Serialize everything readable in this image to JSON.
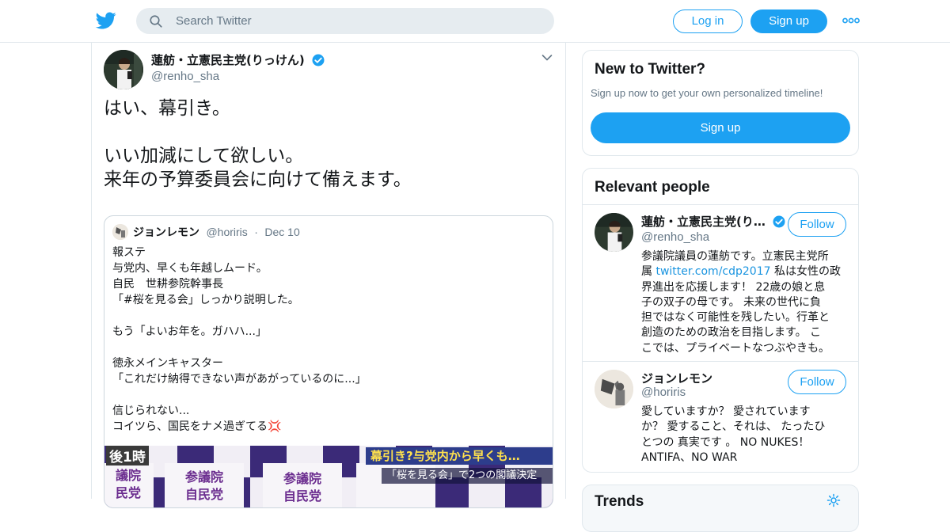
{
  "header": {
    "search_placeholder": "Search Twitter",
    "login_label": "Log in",
    "signup_label": "Sign up",
    "brand_color": "#1da1f2"
  },
  "tweet": {
    "author_name": "蓮舫・立憲民主党(りっけん)",
    "author_handle": "@renho_sha",
    "verified": true,
    "text_lines": [
      "はい、幕引き。",
      "",
      "いい加減にして欲しい。",
      "来年の予算委員会に向けて備えます。"
    ],
    "quote": {
      "author_name": "ジョンレモン",
      "author_handle": "@horiris",
      "separator": "·",
      "date": "Dec 10",
      "lines": [
        "報ステ",
        "与党内、早くも年越しムード。",
        "自民　世耕参院幹事長",
        "「#桜を見る会」しっかり説明した。",
        "",
        "もう「よいお年を。ガハハ...」",
        "",
        "徳永メインキャスター",
        "「これだけ納得できない声があがっているのに...」",
        "",
        "信じられない...",
        "コイツら、国民をナメ過ぎてる💢"
      ],
      "media": {
        "time_text": "後1時",
        "chyron": "幕引き?与党内から早くも…",
        "subchyron": "「桜を見る会」で2つの閣議決定",
        "sign_text_1": "参議院",
        "sign_text_2": "自民党",
        "sign_text_3": "参議院",
        "sign_text_4": "自民党",
        "sign_text_5": "議院",
        "sign_text_6": "民党"
      }
    }
  },
  "sidebar": {
    "new_to_twitter": {
      "title": "New to Twitter?",
      "subtitle": "Sign up now to get your own personalized timeline!",
      "button": "Sign up"
    },
    "relevant_people": {
      "title": "Relevant people",
      "people": [
        {
          "name": "蓮舫・立憲民主党(り…",
          "handle": "@renho_sha",
          "verified": true,
          "follow_label": "Follow",
          "bio_lines": [
            "参議院議員の蓮舫です。立憲民主党所",
            "属 ",
            "界進出を応援します！ 22歳の娘と息",
            "子の双子の母です。 未来の世代に負",
            "担ではなく可能性を残したい。行革と",
            "創造のための政治を目指します。 こ",
            "こでは、プライベートなつぶやきも。"
          ],
          "bio_link": "twitter.com/cdp2017",
          "bio_line2_tail": " 私は女性の政"
        },
        {
          "name": "ジョンレモン",
          "handle": "@horiris",
          "verified": false,
          "follow_label": "Follow",
          "bio_lines": [
            "愛していますか？ 愛されています",
            "か？ 愛すること、それは、 たったひ",
            "とつの 真実です 。 NO NUKES！",
            "ANTIFA、NO WAR"
          ]
        }
      ]
    },
    "trends": {
      "title": "Trends"
    }
  }
}
